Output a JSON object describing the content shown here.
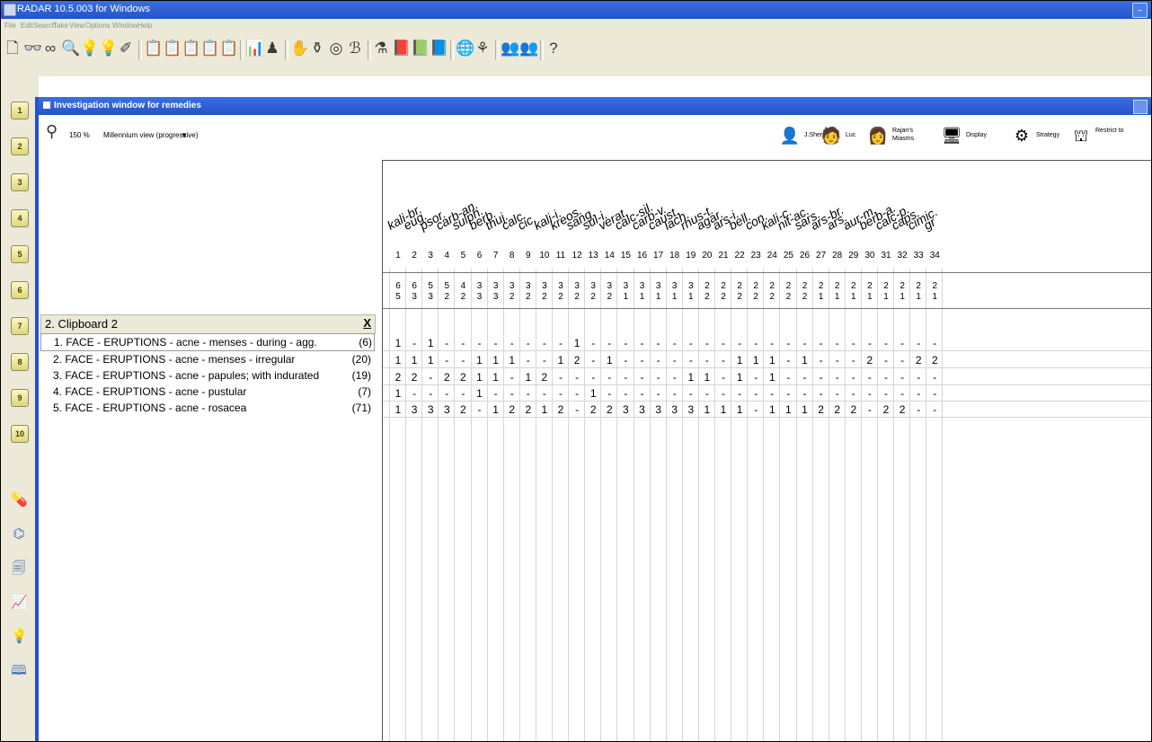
{
  "window": {
    "title": "RADAR 10.5.003 for Windows",
    "menu": [
      "File",
      "Edit",
      "Search",
      "Take",
      "View",
      "Options",
      "Window",
      "Help"
    ]
  },
  "toolbar_icons": [
    "new-doc-icon",
    "binoculars-icon",
    "glasses-icon",
    "magnifier-icon",
    "bulb-icon",
    "bulb-plus-icon",
    "wand-icon",
    "clipboard-1-icon",
    "clipboard-2-icon",
    "clipboard-3-icon",
    "clipboard-4-icon",
    "clipboard-5-icon",
    "bar-chart-icon",
    "person-tree-icon",
    "hand-icon",
    "pot-icon",
    "target-icon",
    "dividers-icon",
    "flask-icon",
    "book-1-icon",
    "book-2-icon",
    "book-3-icon",
    "globe-icon",
    "bowl-icon",
    "people-icon",
    "people-2-icon",
    "help-icon"
  ],
  "sidebar": {
    "numbered": [
      "1",
      "2",
      "3",
      "4",
      "5",
      "6",
      "7",
      "8",
      "9",
      "10"
    ],
    "icons": [
      "pill-icon",
      "leaf-icon",
      "document-icon",
      "chart-icon",
      "question-bulb-icon",
      "encyclopedia-icon"
    ]
  },
  "investigation": {
    "title": "Investigation window for remedies",
    "zoom": "150 %",
    "view_mode": "Millennium view (progressive)",
    "right_buttons": [
      {
        "icon": "person-icon",
        "label": "J.Sher"
      },
      {
        "icon": "person-2-icon",
        "label": "Luc"
      },
      {
        "icon": "person-3-icon",
        "label": "Rajan's Miasms"
      },
      {
        "icon": "display-icon",
        "label": "Display"
      },
      {
        "icon": "strategy-icon",
        "label": "Strategy"
      },
      {
        "icon": "restrict-icon",
        "label": "Restrict to"
      }
    ]
  },
  "clipboard": {
    "title": "2. Clipboard 2",
    "close": "X",
    "rubrics": [
      {
        "label": "1. FACE - ERUPTIONS - acne - menses - during - agg.",
        "count": "(6)"
      },
      {
        "label": "2. FACE - ERUPTIONS - acne - menses - irregular",
        "count": "(20)"
      },
      {
        "label": "3. FACE - ERUPTIONS - acne - papules; with indurated",
        "count": "(19)"
      },
      {
        "label": "4. FACE - ERUPTIONS - acne - pustular",
        "count": "(7)"
      },
      {
        "label": "5. FACE - ERUPTIONS - acne - rosacea",
        "count": "(71)"
      }
    ]
  },
  "remedies": [
    {
      "n": "1",
      "name": "kali-br.",
      "t1": "6",
      "t2": "5"
    },
    {
      "n": "2",
      "name": "eug.",
      "t1": "6",
      "t2": "3"
    },
    {
      "n": "3",
      "name": "psor.",
      "t1": "5",
      "t2": "3"
    },
    {
      "n": "4",
      "name": "carb-an.",
      "t1": "5",
      "t2": "2"
    },
    {
      "n": "5",
      "name": "sulph.",
      "t1": "4",
      "t2": "2"
    },
    {
      "n": "6",
      "name": "berb.",
      "t1": "3",
      "t2": "3"
    },
    {
      "n": "7",
      "name": "thuj.",
      "t1": "3",
      "t2": "3"
    },
    {
      "n": "8",
      "name": "calc.",
      "t1": "3",
      "t2": "2"
    },
    {
      "n": "9",
      "name": "cic.",
      "t1": "3",
      "t2": "2"
    },
    {
      "n": "10",
      "name": "kali-i.",
      "t1": "3",
      "t2": "2"
    },
    {
      "n": "11",
      "name": "kreos.",
      "t1": "3",
      "t2": "2"
    },
    {
      "n": "12",
      "name": "sang.",
      "t1": "3",
      "t2": "2"
    },
    {
      "n": "13",
      "name": "sul-i.",
      "t1": "3",
      "t2": "2"
    },
    {
      "n": "14",
      "name": "verat.",
      "t1": "3",
      "t2": "2"
    },
    {
      "n": "15",
      "name": "calc-sil.",
      "t1": "3",
      "t2": "1"
    },
    {
      "n": "16",
      "name": "carb-v.",
      "t1": "3",
      "t2": "1"
    },
    {
      "n": "17",
      "name": "caust.",
      "t1": "3",
      "t2": "1"
    },
    {
      "n": "18",
      "name": "lach.",
      "t1": "3",
      "t2": "1"
    },
    {
      "n": "19",
      "name": "rhus-t.",
      "t1": "3",
      "t2": "1"
    },
    {
      "n": "20",
      "name": "agar.",
      "t1": "2",
      "t2": "2"
    },
    {
      "n": "21",
      "name": "ars-i.",
      "t1": "2",
      "t2": "2"
    },
    {
      "n": "22",
      "name": "bell.",
      "t1": "2",
      "t2": "2"
    },
    {
      "n": "23",
      "name": "con.",
      "t1": "2",
      "t2": "2"
    },
    {
      "n": "24",
      "name": "kali-c.",
      "t1": "2",
      "t2": "2"
    },
    {
      "n": "25",
      "name": "nit-ac.",
      "t1": "2",
      "t2": "2"
    },
    {
      "n": "26",
      "name": "sars.",
      "t1": "2",
      "t2": "2"
    },
    {
      "n": "27",
      "name": "ars-br.",
      "t1": "2",
      "t2": "1"
    },
    {
      "n": "28",
      "name": "ars.",
      "t1": "2",
      "t2": "1"
    },
    {
      "n": "29",
      "name": "aur-m.",
      "t1": "2",
      "t2": "1"
    },
    {
      "n": "30",
      "name": "berb-a.",
      "t1": "2",
      "t2": "1"
    },
    {
      "n": "31",
      "name": "calc-p.",
      "t1": "2",
      "t2": "1"
    },
    {
      "n": "32",
      "name": "caps.",
      "t1": "2",
      "t2": "1"
    },
    {
      "n": "33",
      "name": "cimic.",
      "t1": "2",
      "t2": "1"
    },
    {
      "n": "34",
      "name": "gr",
      "t1": "2",
      "t2": "1"
    }
  ],
  "grades": [
    [
      "1",
      "-",
      "1",
      "-",
      "-",
      "-",
      "-",
      "-",
      "-",
      "-",
      "-",
      "1",
      "-",
      "-",
      "-",
      "-",
      "-",
      "-",
      "-",
      "-",
      "-",
      "-",
      "-",
      "-",
      "-",
      "-",
      "-",
      "-",
      "-",
      "-",
      "-",
      "-",
      "-",
      "-"
    ],
    [
      "1",
      "1",
      "1",
      "-",
      "-",
      "1",
      "1",
      "1",
      "-",
      "-",
      "1",
      "2",
      "-",
      "1",
      "-",
      "-",
      "-",
      "-",
      "-",
      "-",
      "-",
      "1",
      "1",
      "1",
      "-",
      "1",
      "-",
      "-",
      "-",
      "2",
      "-",
      "-",
      "2",
      "2"
    ],
    [
      "2",
      "2",
      "-",
      "2",
      "2",
      "1",
      "1",
      "-",
      "1",
      "2",
      "-",
      "-",
      "-",
      "-",
      "-",
      "-",
      "-",
      "-",
      "1",
      "1",
      "-",
      "1",
      "-",
      "1",
      "-",
      "-",
      "-",
      "-",
      "-",
      "-",
      "-",
      "-",
      "-",
      "-"
    ],
    [
      "1",
      "-",
      "-",
      "-",
      "-",
      "1",
      "-",
      "-",
      "-",
      "-",
      "-",
      "-",
      "1",
      "-",
      "-",
      "-",
      "-",
      "-",
      "-",
      "-",
      "-",
      "-",
      "-",
      "-",
      "-",
      "-",
      "-",
      "-",
      "-",
      "-",
      "-",
      "-",
      "-",
      "-"
    ],
    [
      "1",
      "3",
      "3",
      "3",
      "2",
      "-",
      "1",
      "2",
      "2",
      "1",
      "2",
      "-",
      "2",
      "2",
      "3",
      "3",
      "3",
      "3",
      "3",
      "1",
      "1",
      "1",
      "-",
      "1",
      "1",
      "1",
      "2",
      "2",
      "2",
      "-",
      "2",
      "2",
      "-",
      "-"
    ]
  ]
}
